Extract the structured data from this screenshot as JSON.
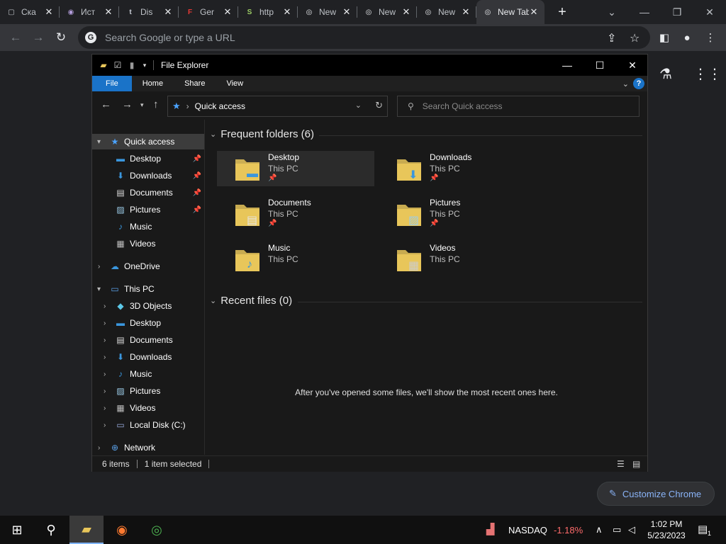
{
  "chrome": {
    "tabs": [
      {
        "title": "Ска",
        "icon": "window-icon",
        "icon_glyph": "▢",
        "icon_color": "#bdc1c6"
      },
      {
        "title": "Ист",
        "icon": "podcast-icon",
        "icon_glyph": "◉",
        "icon_color": "#b39ddb"
      },
      {
        "title": "Dis",
        "icon": "tumblr-icon",
        "icon_glyph": "t",
        "icon_color": "#c8cdd6"
      },
      {
        "title": "Ger",
        "icon": "f-logo-icon",
        "icon_glyph": "F",
        "icon_color": "#e53935"
      },
      {
        "title": "http",
        "icon": "s-logo-icon",
        "icon_glyph": "S",
        "icon_color": "#9ccc65"
      },
      {
        "title": "New",
        "icon": "chrome-icon",
        "icon_glyph": "◎",
        "icon_color": "#e8eaed"
      },
      {
        "title": "New",
        "icon": "chrome-icon",
        "icon_glyph": "◎",
        "icon_color": "#e8eaed"
      },
      {
        "title": "New",
        "icon": "chrome-icon",
        "icon_glyph": "◎",
        "icon_color": "#e8eaed"
      },
      {
        "title": "New Tab",
        "icon": "chrome-icon",
        "icon_glyph": "◎",
        "icon_color": "#e8eaed"
      }
    ],
    "omnibox_placeholder": "Search Google or type a URL",
    "customize_label": "Customize Chrome"
  },
  "explorer": {
    "title": "File Explorer",
    "ribbon_tabs": [
      "File",
      "Home",
      "Share",
      "View"
    ],
    "address": "Quick access",
    "search_placeholder": "Search Quick access",
    "nav": {
      "quick_access": "Quick access",
      "qa_items": [
        "Desktop",
        "Downloads",
        "Documents",
        "Pictures",
        "Music",
        "Videos"
      ],
      "onedrive": "OneDrive",
      "this_pc": "This PC",
      "pc_items": [
        "3D Objects",
        "Desktop",
        "Documents",
        "Downloads",
        "Music",
        "Pictures",
        "Videos",
        "Local Disk (C:)"
      ],
      "network": "Network"
    },
    "frequent_header": "Frequent folders (6)",
    "folders": [
      {
        "name": "Desktop",
        "location": "This PC",
        "pinned": true
      },
      {
        "name": "Downloads",
        "location": "This PC",
        "pinned": true
      },
      {
        "name": "Documents",
        "location": "This PC",
        "pinned": true
      },
      {
        "name": "Pictures",
        "location": "This PC",
        "pinned": true
      },
      {
        "name": "Music",
        "location": "This PC",
        "pinned": false
      },
      {
        "name": "Videos",
        "location": "This PC",
        "pinned": false
      }
    ],
    "recent_header": "Recent files (0)",
    "recent_empty": "After you've opened some files, we'll show the most recent ones here.",
    "status_items": "6 items",
    "status_selected": "1 item selected"
  },
  "taskbar": {
    "stock_name": "NASDAQ",
    "stock_change": "-1.18%",
    "time": "1:02 PM",
    "date": "5/23/2023",
    "notification_count": "1"
  },
  "colors": {
    "accent": "#1a73c8",
    "folder": "#e8c65a",
    "stock_down": "#ff6b6b"
  }
}
